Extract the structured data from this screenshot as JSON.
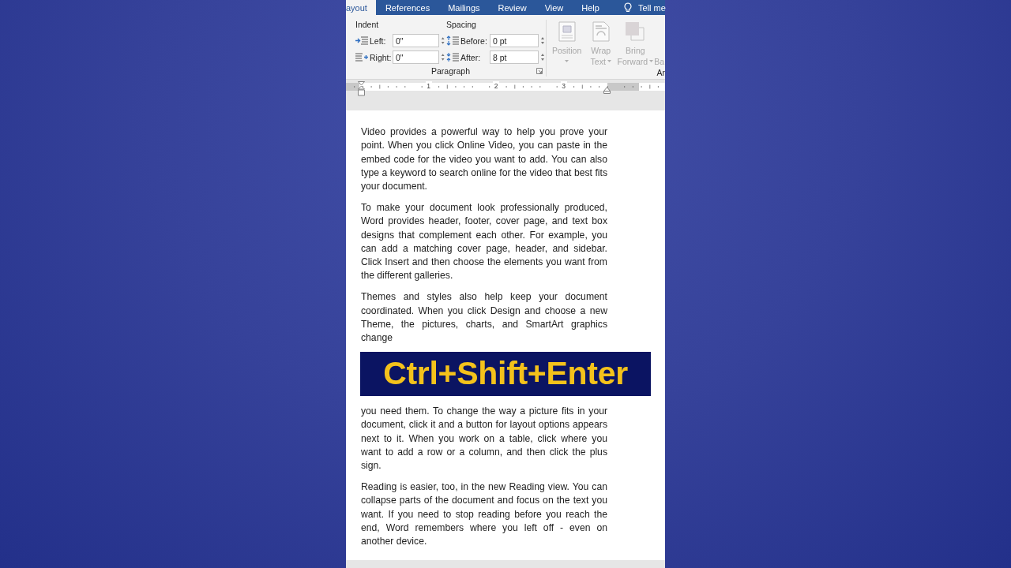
{
  "tabs": [
    {
      "label": "ayout",
      "selected": true
    },
    {
      "label": "References",
      "selected": false
    },
    {
      "label": "Mailings",
      "selected": false
    },
    {
      "label": "Review",
      "selected": false
    },
    {
      "label": "View",
      "selected": false
    },
    {
      "label": "Help",
      "selected": false
    }
  ],
  "tell_me": "Tell me",
  "paragraph_group": {
    "title": "Paragraph",
    "indent": {
      "label": "Indent",
      "fields": [
        {
          "kind": "indent-left",
          "label": "Left:",
          "value": "0\""
        },
        {
          "kind": "indent-right",
          "label": "Right:",
          "value": "0\""
        }
      ]
    },
    "spacing": {
      "label": "Spacing",
      "fields": [
        {
          "kind": "space-before",
          "label": "Before:",
          "value": "0 pt"
        },
        {
          "kind": "space-after",
          "label": "After:",
          "value": "8 pt"
        }
      ]
    }
  },
  "arrange_group": {
    "title": "Ar",
    "buttons": [
      {
        "kind": "position",
        "lines": [
          "Position"
        ],
        "disabled": true,
        "has_menu": true
      },
      {
        "kind": "wrap",
        "lines": [
          "Wrap",
          "Text"
        ],
        "disabled": true,
        "has_menu": true
      },
      {
        "kind": "bring-forward",
        "lines": [
          "Bring",
          "Forward"
        ],
        "disabled": true,
        "has_menu": true
      },
      {
        "kind": "cut",
        "lines": [
          "Ba"
        ],
        "disabled": true,
        "has_menu": false
      }
    ]
  },
  "ruler": {
    "numbers": [
      "1",
      "2",
      "3"
    ]
  },
  "document": {
    "blocks": [
      {
        "kind": "paragraph",
        "text": "Video provides a powerful way to help you prove your point. When you click Online Video, you can paste in the embed code for the video you want to add. You can also type a keyword to search online for the video that best fits your document."
      },
      {
        "kind": "paragraph",
        "text": "To make your document look professionally produced, Word provides header, footer, cover page, and text box designs that complement each other. For example, you can add a matching cover page, header, and sidebar. Click Insert and then choose the elements you want from the different galleries."
      },
      {
        "kind": "paragraph",
        "text": "Themes and styles also help keep your document coordinated. When you click Design and choose a new Theme, the pictures, charts, and SmartArt graphics change"
      },
      {
        "kind": "overlay",
        "text": "Ctrl+Shift+Enter"
      },
      {
        "kind": "continuation",
        "text": "you need them. To change the way a picture fits in your document, click it and a button for layout options appears next to it. When you work on a table, click where you want to add a row or a column, and then click the plus sign."
      },
      {
        "kind": "paragraph",
        "text": "Reading is easier, too, in the new Reading view. You can collapse parts of the document and focus on the text you want. If you need to stop reading before you reach the end, Word remembers where you left off - even on another device."
      }
    ]
  }
}
